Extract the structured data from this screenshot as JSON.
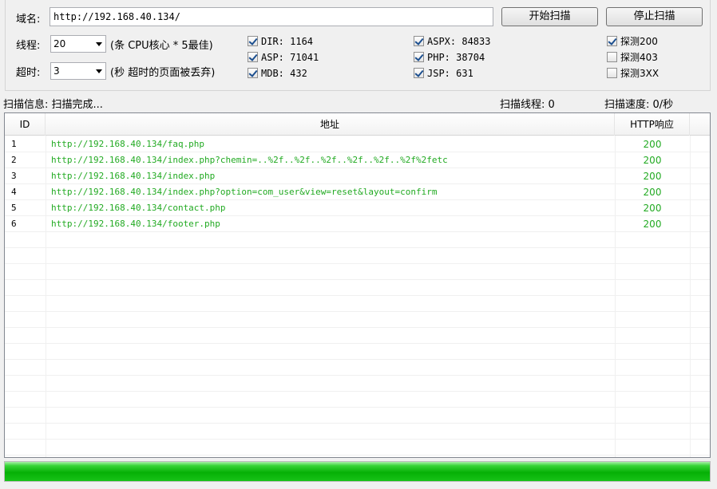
{
  "form": {
    "domain_label": "域名:",
    "domain_value": "http://192.168.40.134/",
    "start_button": "开始扫描",
    "stop_button": "停止扫描",
    "threads_label": "线程:",
    "threads_value": "20",
    "threads_hint": "(条 CPU核心 * 5最佳)",
    "timeout_label": "超时:",
    "timeout_value": "3",
    "timeout_hint": "(秒 超时的页面被丢弃)"
  },
  "dicts": [
    {
      "label": "DIR: 1164",
      "checked": true
    },
    {
      "label": "ASP: 71041",
      "checked": true
    },
    {
      "label": "MDB: 432",
      "checked": true
    },
    {
      "label": "ASPX: 84833",
      "checked": true
    },
    {
      "label": "PHP: 38704",
      "checked": true
    },
    {
      "label": "JSP: 631",
      "checked": true
    }
  ],
  "detect": [
    {
      "label": "探测200",
      "checked": true
    },
    {
      "label": "探测403",
      "checked": false
    },
    {
      "label": "探测3XX",
      "checked": false
    }
  ],
  "status": {
    "info": "扫描信息: 扫描完成...",
    "threads": "扫描线程: 0",
    "speed": "扫描速度: 0/秒"
  },
  "table": {
    "headers": {
      "id": "ID",
      "url": "地址",
      "code": "HTTP响应"
    },
    "rows": [
      {
        "id": "1",
        "url": "http://192.168.40.134/faq.php",
        "code": "200"
      },
      {
        "id": "2",
        "url": "http://192.168.40.134/index.php?chemin=..%2f..%2f..%2f..%2f..%2f..%2f%2fetc",
        "code": "200"
      },
      {
        "id": "3",
        "url": "http://192.168.40.134/index.php",
        "code": "200"
      },
      {
        "id": "4",
        "url": "http://192.168.40.134/index.php?option=com_user&view=reset&layout=confirm",
        "code": "200"
      },
      {
        "id": "5",
        "url": "http://192.168.40.134/contact.php",
        "code": "200"
      },
      {
        "id": "6",
        "url": "http://192.168.40.134/footer.php",
        "code": "200"
      }
    ]
  },
  "progress": {
    "fraction": 1.0
  },
  "colors": {
    "url_text": "#22aa22",
    "progress": "#06b006"
  }
}
